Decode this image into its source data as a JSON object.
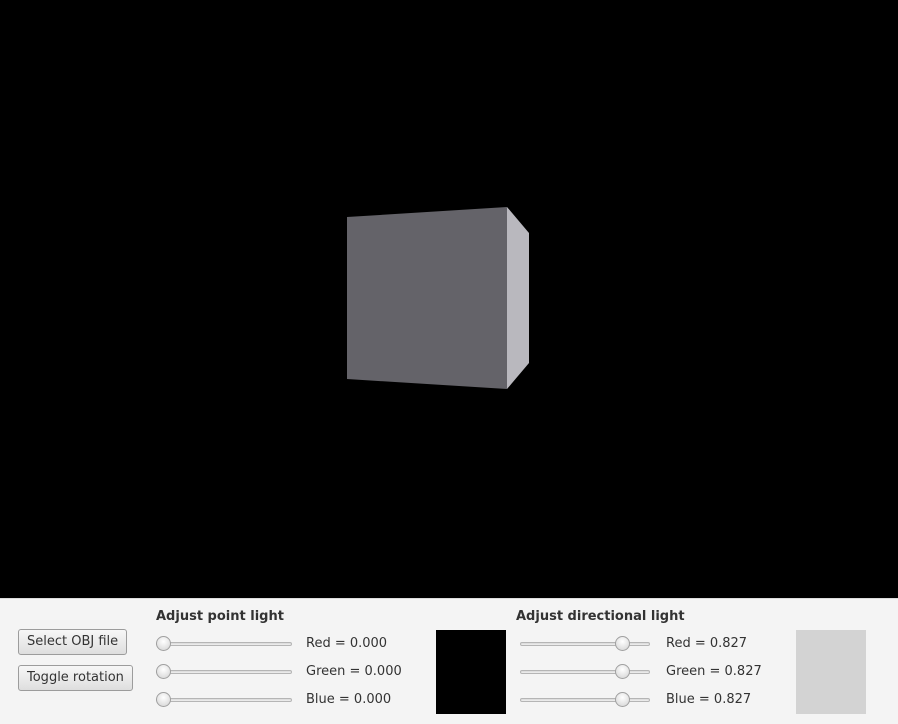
{
  "viewport": {
    "background": "#000000",
    "object": "cube",
    "front_face_color": "#646369",
    "side_face_color": "#b9b8be"
  },
  "buttons": {
    "select_obj": "Select OBJ file",
    "toggle_rotation": "Toggle rotation"
  },
  "point_light": {
    "title": "Adjust point light",
    "red": {
      "label": "Red = 0.000",
      "value": 0.0
    },
    "green": {
      "label": "Green = 0.000",
      "value": 0.0
    },
    "blue": {
      "label": "Blue = 0.000",
      "value": 0.0
    },
    "swatch_color": "#000000"
  },
  "directional_light": {
    "title": "Adjust directional light",
    "red": {
      "label": "Red = 0.827",
      "value": 0.827
    },
    "green": {
      "label": "Green = 0.827",
      "value": 0.827
    },
    "blue": {
      "label": "Blue = 0.827",
      "value": 0.827
    },
    "swatch_color": "#d3d3d3"
  }
}
